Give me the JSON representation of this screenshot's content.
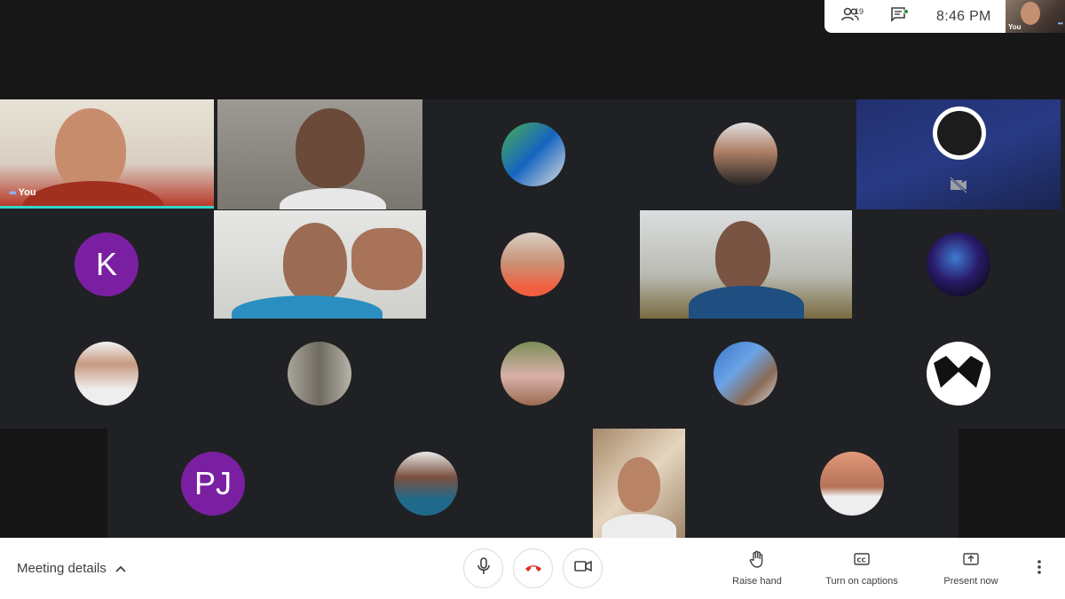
{
  "topbar": {
    "participant_count": "19",
    "time": "8:46 PM",
    "self_label": "You"
  },
  "tiles": {
    "you_label": "You",
    "k_initial": "K",
    "pj_initials": "PJ"
  },
  "bottom": {
    "meeting_details": "Meeting details",
    "raise_hand": "Raise hand",
    "captions": "Turn on captions",
    "present": "Present now"
  },
  "colors": {
    "background": "#202124",
    "avatar_purple": "#7b1fa2",
    "end_call_red": "#d93025",
    "speaking_indicator": "#34d5c8"
  },
  "icons": [
    "people-icon",
    "chat-icon",
    "mic-icon",
    "end-call-icon",
    "camera-icon",
    "hand-icon",
    "captions-icon",
    "present-icon",
    "more-vert-icon",
    "chevron-up-icon",
    "camera-off-icon"
  ]
}
